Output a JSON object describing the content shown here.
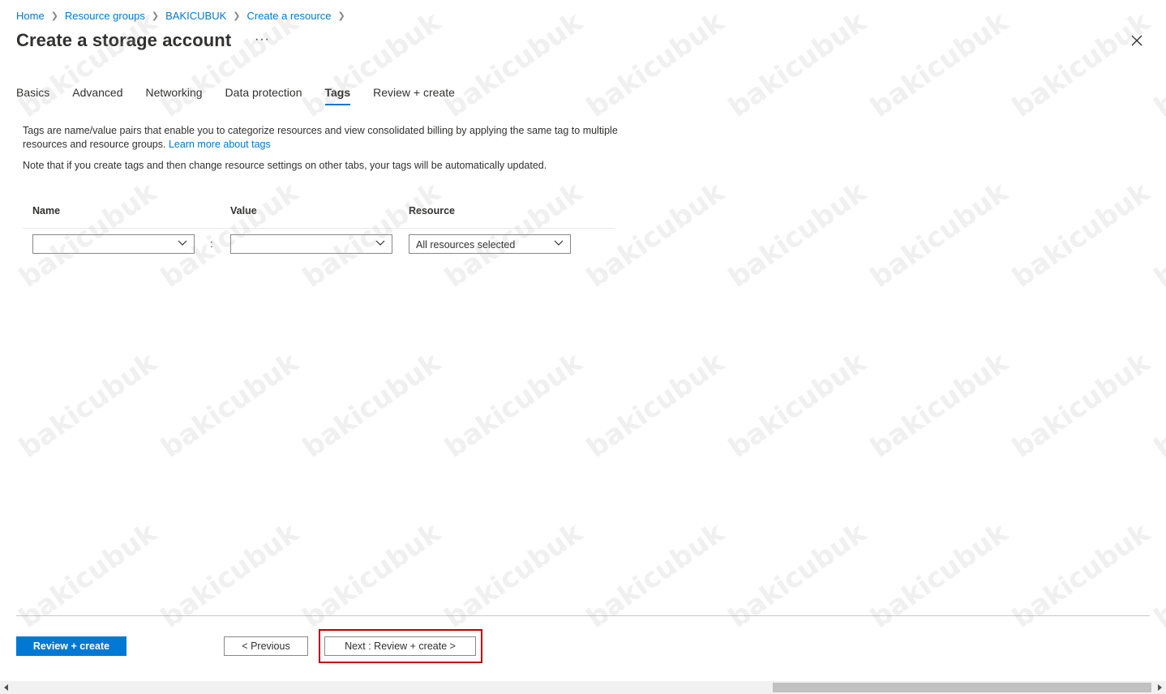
{
  "breadcrumb": {
    "items": [
      "Home",
      "Resource groups",
      "BAKICUBUK",
      "Create a resource"
    ]
  },
  "page": {
    "title": "Create a storage account",
    "more": "···"
  },
  "tabs": [
    "Basics",
    "Advanced",
    "Networking",
    "Data protection",
    "Tags",
    "Review + create"
  ],
  "active_tab": "Tags",
  "content": {
    "description": "Tags are name/value pairs that enable you to categorize resources and view consolidated billing by applying the same tag to multiple resources and resource groups.",
    "learn_more": "Learn more about tags",
    "note": "Note that if you create tags and then change resource settings on other tabs, your tags will be automatically updated."
  },
  "tag_grid": {
    "headers": {
      "name": "Name",
      "value": "Value",
      "resource": "Resource"
    },
    "row": {
      "name": "",
      "separator": ":",
      "value": "",
      "resource": "All resources selected"
    }
  },
  "footer": {
    "review_create": "Review + create",
    "previous": "< Previous",
    "next": "Next : Review + create >"
  },
  "colors": {
    "accent": "#0078d4",
    "highlight_box": "#c00000"
  },
  "watermark": "bakicubuk"
}
